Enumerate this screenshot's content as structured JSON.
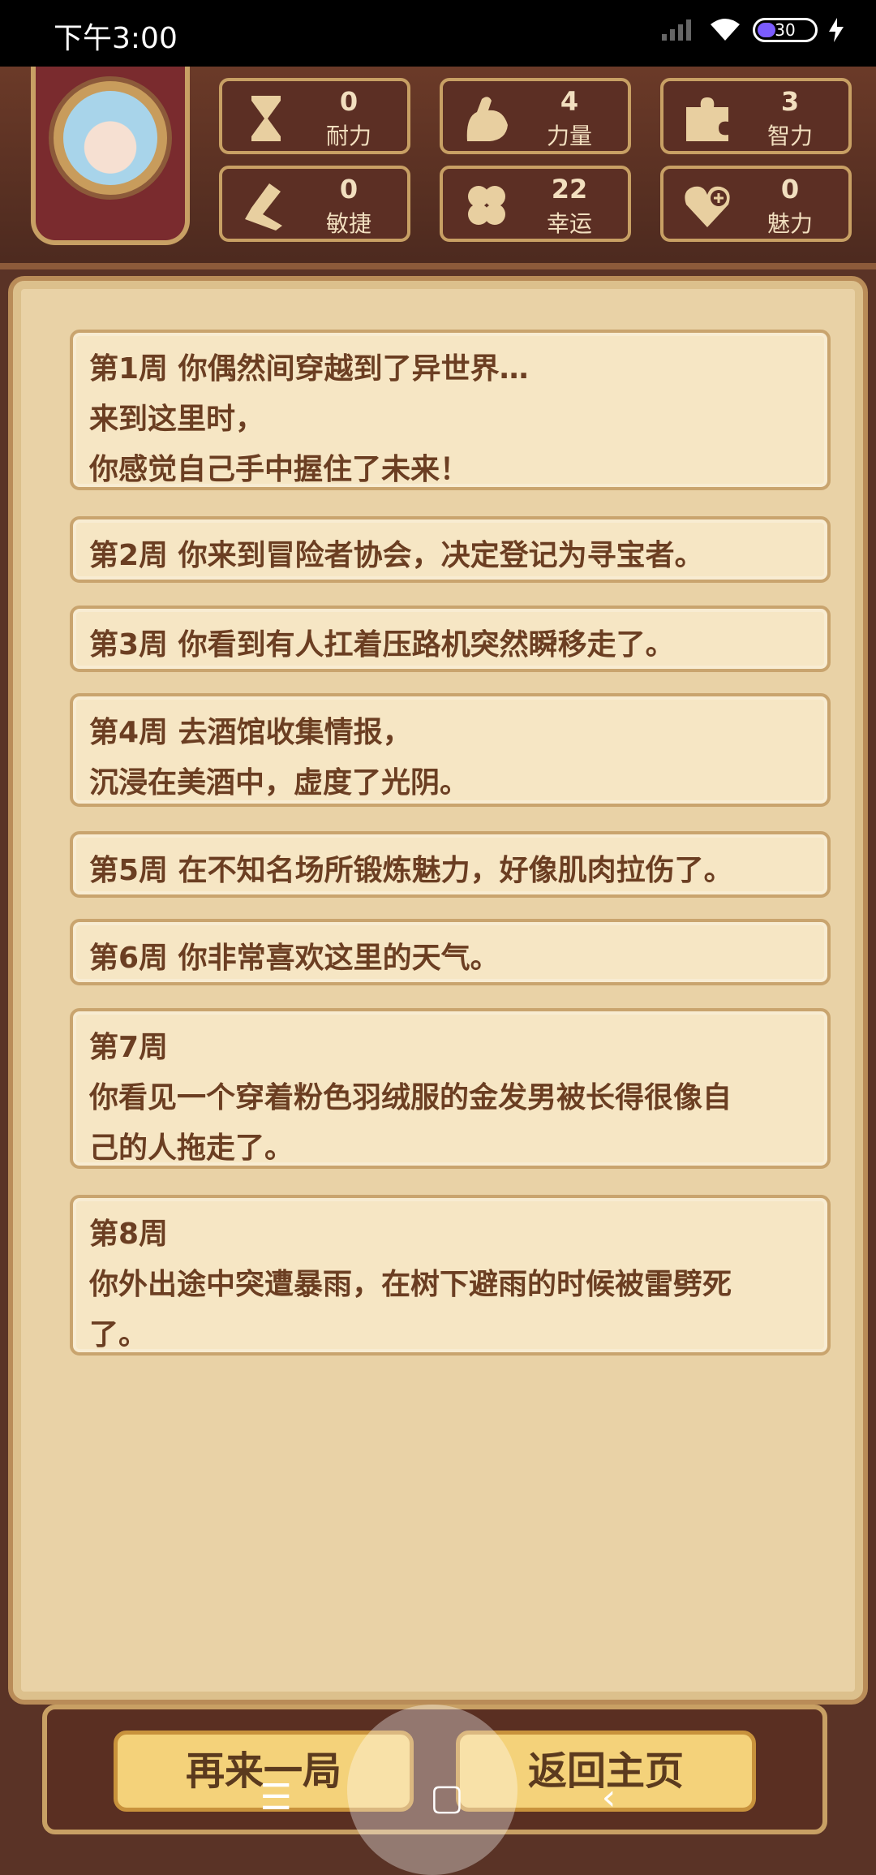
{
  "status_bar": {
    "time": "下午3:00",
    "battery": "30"
  },
  "stats": [
    {
      "value": "0",
      "label": "耐力",
      "icon": "hourglass-icon"
    },
    {
      "value": "4",
      "label": "力量",
      "icon": "muscle-arm-icon"
    },
    {
      "value": "3",
      "label": "智力",
      "icon": "puzzle-icon"
    },
    {
      "value": "0",
      "label": "敏捷",
      "icon": "boot-icon"
    },
    {
      "value": "22",
      "label": "幸运",
      "icon": "clover-icon"
    },
    {
      "value": "0",
      "label": "魅力",
      "icon": "heart-plus-icon"
    }
  ],
  "events": [
    {
      "lines": [
        "第1周 你偶然间穿越到了异世界…",
        "来到这里时，",
        "你感觉自己手中握住了未来！"
      ]
    },
    {
      "lines": [
        "第2周 你来到冒险者协会，决定登记为寻宝者。"
      ]
    },
    {
      "lines": [
        "第3周 你看到有人扛着压路机突然瞬移走了。"
      ]
    },
    {
      "lines": [
        "第4周 去酒馆收集情报，",
        "沉浸在美酒中，虚度了光阴。"
      ]
    },
    {
      "lines": [
        "第5周 在不知名场所锻炼魅力，好像肌肉拉伤了。"
      ]
    },
    {
      "lines": [
        "第6周 你非常喜欢这里的天气。"
      ]
    },
    {
      "lines": [
        "第7周",
        "你看见一个穿着粉色羽绒服的金发男被长得很像自",
        "己的人拖走了。"
      ]
    },
    {
      "lines": [
        "第8周",
        "你外出途中突遭暴雨，在树下避雨的时候被雷劈死",
        "了。"
      ]
    }
  ],
  "buttons": {
    "retry": "再来一局",
    "home": "返回主页"
  },
  "navbar": {
    "menu": "☰",
    "home": "▢",
    "back": "‹"
  }
}
